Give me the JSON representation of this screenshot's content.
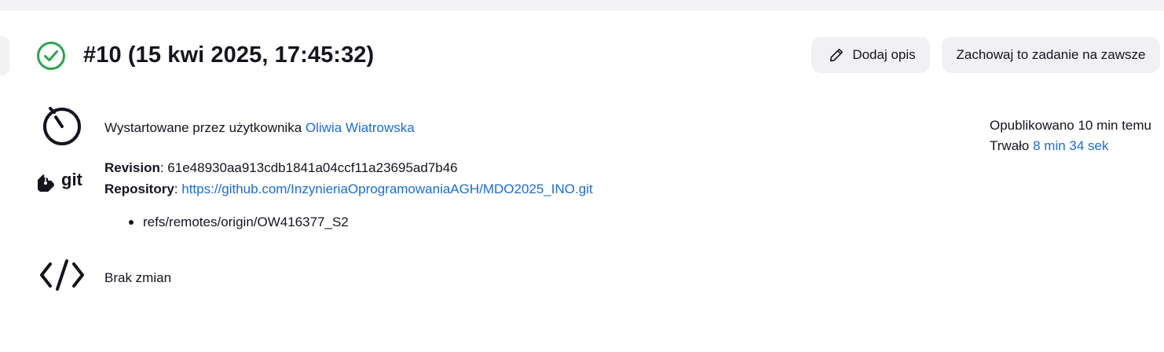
{
  "header": {
    "build_title": "#10 (15 kwi 2025, 17:45:32)",
    "status": "success"
  },
  "actions": {
    "add_description_label": "Dodaj opis",
    "keep_forever_label": "Zachowaj to zadanie na zawsze"
  },
  "started": {
    "prefix": "Wystartowane przez użytkownika ",
    "user": "Oliwia Wiatrowska"
  },
  "git": {
    "revision_label": "Revision",
    "revision_value": ": 61e48930aa913cdb1841a04ccf11a23695ad7b46",
    "repository_label": "Repository",
    "repository_sep": ": ",
    "repository_url": "https://github.com/InzynieriaOprogramowaniaAGH/MDO2025_INO.git",
    "branches": [
      "refs/remotes/origin/OW416377_S2"
    ]
  },
  "changes": {
    "text": "Brak zmian"
  },
  "meta": {
    "published": "Opublikowano 10 min temu",
    "duration_prefix": "Trwało ",
    "duration": "8 min 34 sek"
  },
  "icons": {
    "status": "check-circle-icon",
    "edit": "pencil-icon",
    "timer": "stopwatch-icon",
    "git": "git-logo-icon",
    "changes": "code-brackets-icon"
  },
  "colors": {
    "success": "#2aa64a",
    "link": "#1a6dd9",
    "button_bg": "#f1f1f4"
  }
}
